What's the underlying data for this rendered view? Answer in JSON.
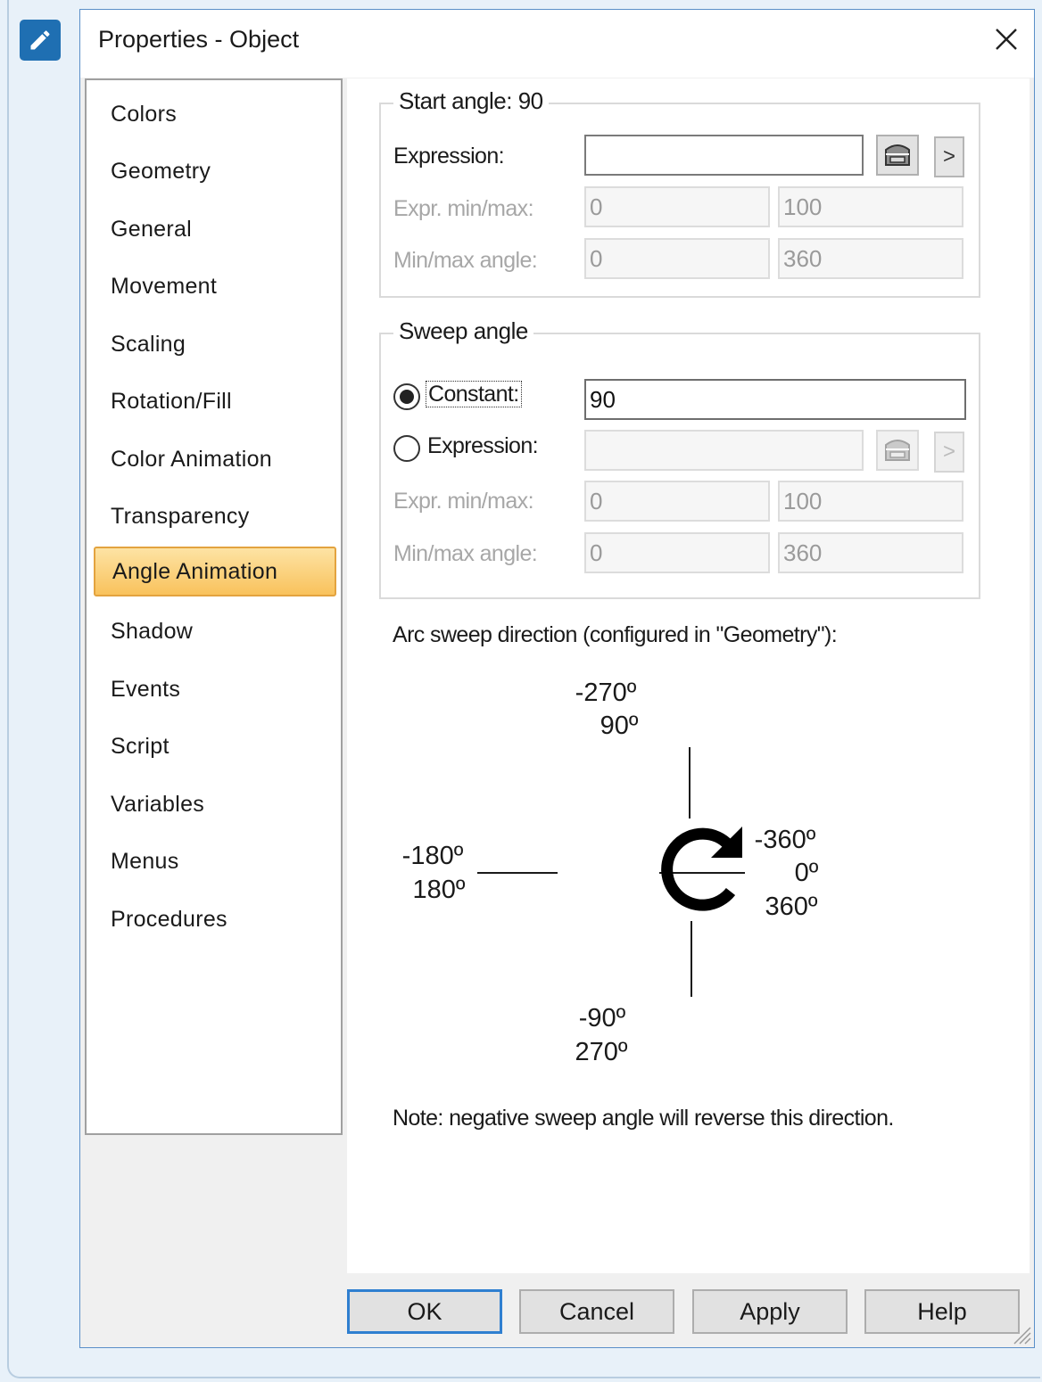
{
  "dialog": {
    "title": "Properties - Object"
  },
  "nav": {
    "items": [
      "Colors",
      "Geometry",
      "General",
      "Movement",
      "Scaling",
      "Rotation/Fill",
      "Color Animation",
      "Transparency",
      "Angle Animation",
      "Shadow",
      "Events",
      "Script",
      "Variables",
      "Menus",
      "Procedures"
    ],
    "selected": "Angle Animation"
  },
  "start_angle": {
    "caption": "Start angle: 90",
    "expression_label": "Expression:",
    "expression_value": "",
    "expr_minmax_label": "Expr. min/max:",
    "expr_min": "0",
    "expr_max": "100",
    "angle_minmax_label": "Min/max angle:",
    "angle_min": "0",
    "angle_max": "360",
    "arrow": ">"
  },
  "sweep_angle": {
    "caption": "Sweep angle",
    "constant_label": "Constant:",
    "constant_value": "90",
    "constant_selected": true,
    "expression_label": "Expression:",
    "expression_value": "",
    "expr_minmax_label": "Expr. min/max:",
    "expr_min": "0",
    "expr_max": "100",
    "angle_minmax_label": "Min/max angle:",
    "angle_min": "0",
    "angle_max": "360",
    "arrow": ">"
  },
  "direction": {
    "heading": "Arc sweep direction (configured in \"Geometry\"):",
    "top_1": "-270º",
    "top_2": "90º",
    "left_1": "-180º",
    "left_2": "180º",
    "right_1": "-360º",
    "right_2": "0º",
    "right_3": "360º",
    "bottom_1": "-90º",
    "bottom_2": "270º",
    "note": "Note: negative sweep angle will reverse this direction."
  },
  "buttons": {
    "ok": "OK",
    "cancel": "Cancel",
    "apply": "Apply",
    "help": "Help"
  },
  "colors": {
    "selected_nav": "#f9c25c",
    "accent_blue": "#1f6fb2",
    "default_button_border": "#2f7fd0"
  }
}
